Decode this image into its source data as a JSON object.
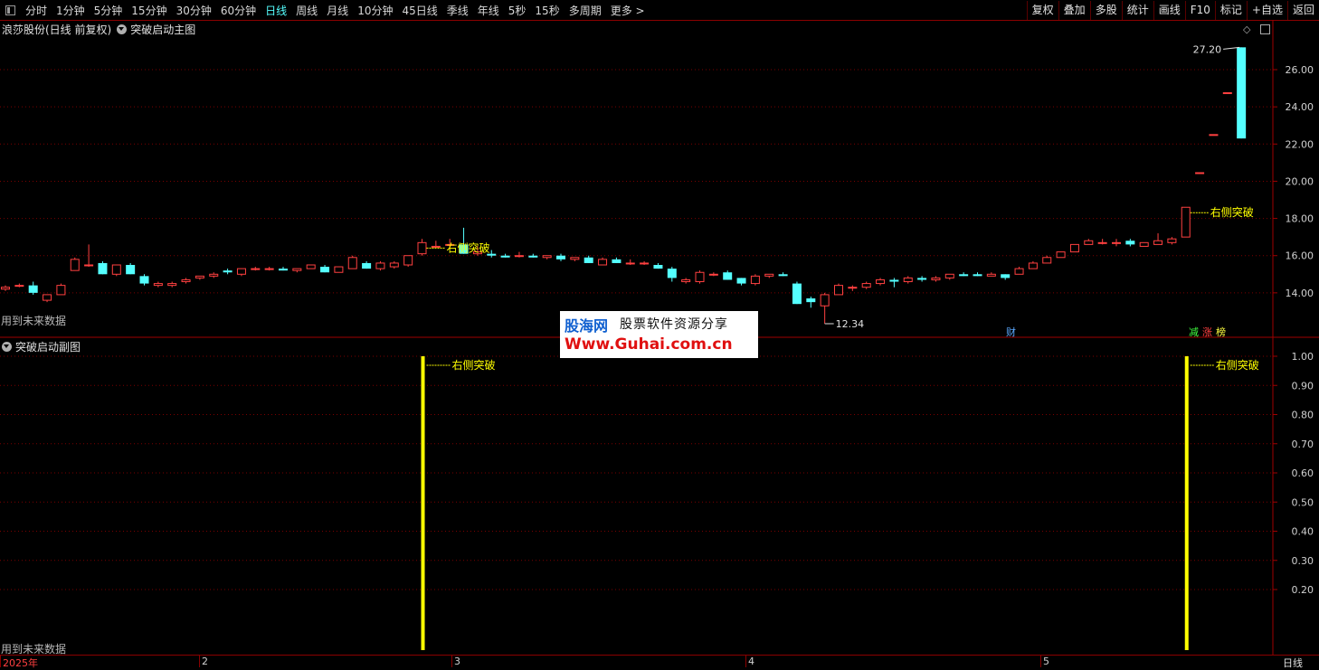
{
  "toolbar": {
    "periods": [
      "分时",
      "1分钟",
      "5分钟",
      "15分钟",
      "30分钟",
      "60分钟",
      "日线",
      "周线",
      "月线",
      "10分钟",
      "45日线",
      "季线",
      "年线",
      "5秒",
      "15秒",
      "多周期",
      "更多 >"
    ],
    "active_period": "日线",
    "right_buttons": [
      "复权",
      "叠加",
      "多股",
      "统计",
      "画线",
      "F10",
      "标记",
      "+自选",
      "返回"
    ]
  },
  "main_panel": {
    "title": "浪莎股份(日线 前复权)",
    "indicator": "突破启动主图",
    "footnote": "用到未来数据",
    "max_label": "27.20",
    "min_label": "12.34",
    "badges": {
      "cai": "财",
      "jian": "减",
      "zhang": "涨",
      "bang": "榜"
    },
    "signal_label": "右侧突破"
  },
  "sub_panel": {
    "indicator": "突破启动副图",
    "footnote": "用到未来数据",
    "signal_label": "右侧突破"
  },
  "x_axis": {
    "labels": [
      "2025年",
      "2",
      "3",
      "4",
      "5"
    ],
    "period_label": "日线"
  },
  "watermark": {
    "brand": "股海网",
    "slogan": "股票软件资源分享",
    "url": "Www.Guhai.com.cn"
  },
  "colors": {
    "up": "#ff4040",
    "down": "#54ffff",
    "signal": "#ffff00",
    "grid": "#7a0000",
    "border": "#a00000"
  },
  "chart_data": [
    {
      "type": "candlestick",
      "title": "浪莎股份(日线 前复权)",
      "ylim": [
        12,
        27.8
      ],
      "y_ticks": [
        14,
        16,
        18,
        20,
        22,
        24,
        26
      ],
      "x_tick_labels": [
        "2025年",
        "2",
        "3",
        "4",
        "5"
      ],
      "ohlc": [
        [
          14.2,
          14.4,
          14.1,
          14.3
        ],
        [
          14.4,
          14.5,
          14.3,
          14.4
        ],
        [
          14.4,
          14.6,
          13.9,
          14.0
        ],
        [
          13.6,
          13.9,
          13.5,
          13.9
        ],
        [
          13.9,
          14.5,
          13.9,
          14.4
        ],
        [
          15.2,
          15.9,
          15.2,
          15.8
        ],
        [
          15.5,
          16.6,
          15.4,
          15.5
        ],
        [
          15.6,
          15.7,
          15.0,
          15.0
        ],
        [
          15.0,
          15.5,
          14.9,
          15.5
        ],
        [
          15.5,
          15.6,
          15.0,
          15.0
        ],
        [
          14.9,
          15.0,
          14.4,
          14.5
        ],
        [
          14.4,
          14.6,
          14.3,
          14.5
        ],
        [
          14.4,
          14.6,
          14.3,
          14.5
        ],
        [
          14.6,
          14.8,
          14.5,
          14.7
        ],
        [
          14.8,
          14.9,
          14.7,
          14.9
        ],
        [
          14.9,
          15.1,
          14.8,
          15.0
        ],
        [
          15.2,
          15.3,
          15.0,
          15.1
        ],
        [
          15.0,
          15.3,
          14.9,
          15.3
        ],
        [
          15.3,
          15.4,
          15.2,
          15.3
        ],
        [
          15.3,
          15.4,
          15.2,
          15.3
        ],
        [
          15.3,
          15.4,
          15.2,
          15.2
        ],
        [
          15.2,
          15.3,
          15.1,
          15.3
        ],
        [
          15.3,
          15.5,
          15.3,
          15.5
        ],
        [
          15.4,
          15.5,
          15.1,
          15.1
        ],
        [
          15.1,
          15.4,
          15.1,
          15.4
        ],
        [
          15.3,
          16.0,
          15.3,
          15.9
        ],
        [
          15.6,
          15.7,
          15.3,
          15.3
        ],
        [
          15.3,
          15.7,
          15.2,
          15.6
        ],
        [
          15.4,
          15.7,
          15.3,
          15.6
        ],
        [
          15.5,
          16.0,
          15.4,
          16.0
        ],
        [
          16.1,
          16.9,
          16.0,
          16.7
        ],
        [
          16.5,
          16.8,
          16.4,
          16.5
        ],
        [
          16.6,
          16.9,
          16.4,
          16.6
        ],
        [
          16.6,
          17.5,
          16.1,
          16.1
        ],
        [
          16.1,
          16.5,
          16.0,
          16.2
        ],
        [
          16.1,
          16.3,
          15.9,
          16.0
        ],
        [
          16.0,
          16.1,
          15.9,
          15.9
        ],
        [
          16.0,
          16.2,
          15.9,
          16.0
        ],
        [
          16.0,
          16.1,
          15.9,
          15.9
        ],
        [
          15.9,
          16.0,
          15.8,
          16.0
        ],
        [
          16.0,
          16.1,
          15.7,
          15.8
        ],
        [
          15.8,
          15.9,
          15.7,
          15.9
        ],
        [
          15.9,
          16.0,
          15.6,
          15.6
        ],
        [
          15.5,
          15.9,
          15.5,
          15.8
        ],
        [
          15.8,
          15.9,
          15.6,
          15.6
        ],
        [
          15.6,
          15.8,
          15.5,
          15.6
        ],
        [
          15.6,
          15.7,
          15.5,
          15.6
        ],
        [
          15.5,
          15.6,
          15.3,
          15.3
        ],
        [
          15.3,
          15.4,
          14.6,
          14.8
        ],
        [
          14.6,
          14.8,
          14.5,
          14.7
        ],
        [
          14.6,
          15.2,
          14.5,
          15.1
        ],
        [
          15.0,
          15.1,
          14.9,
          15.0
        ],
        [
          15.1,
          15.2,
          14.7,
          14.7
        ],
        [
          14.8,
          14.8,
          14.4,
          14.5
        ],
        [
          14.5,
          15.0,
          14.4,
          14.9
        ],
        [
          14.9,
          15.0,
          14.8,
          15.0
        ],
        [
          15.0,
          15.1,
          14.9,
          14.9
        ],
        [
          14.5,
          14.6,
          13.4,
          13.4
        ],
        [
          13.7,
          13.8,
          13.2,
          13.5
        ],
        [
          13.3,
          14.0,
          12.34,
          13.9
        ],
        [
          13.9,
          14.5,
          13.9,
          14.4
        ],
        [
          14.3,
          14.4,
          14.1,
          14.3
        ],
        [
          14.3,
          14.6,
          14.2,
          14.5
        ],
        [
          14.5,
          14.8,
          14.4,
          14.7
        ],
        [
          14.7,
          14.8,
          14.3,
          14.6
        ],
        [
          14.6,
          14.9,
          14.5,
          14.8
        ],
        [
          14.8,
          14.9,
          14.6,
          14.7
        ],
        [
          14.7,
          14.9,
          14.6,
          14.8
        ],
        [
          14.8,
          15.0,
          14.7,
          15.0
        ],
        [
          15.0,
          15.1,
          14.9,
          14.9
        ],
        [
          15.0,
          15.1,
          14.9,
          14.9
        ],
        [
          14.9,
          15.1,
          14.9,
          15.0
        ],
        [
          15.0,
          15.0,
          14.7,
          14.8
        ],
        [
          15.0,
          15.4,
          15.0,
          15.3
        ],
        [
          15.3,
          15.7,
          15.3,
          15.6
        ],
        [
          15.6,
          16.0,
          15.6,
          15.9
        ],
        [
          15.9,
          16.2,
          15.9,
          16.2
        ],
        [
          16.2,
          16.6,
          16.2,
          16.6
        ],
        [
          16.6,
          16.9,
          16.6,
          16.8
        ],
        [
          16.7,
          16.9,
          16.6,
          16.7
        ],
        [
          16.7,
          16.9,
          16.5,
          16.7
        ],
        [
          16.8,
          16.9,
          16.5,
          16.6
        ],
        [
          16.5,
          16.7,
          16.5,
          16.7
        ],
        [
          16.6,
          17.2,
          16.6,
          16.8
        ],
        [
          16.7,
          17.0,
          16.6,
          16.9
        ],
        [
          17.0,
          18.6,
          17.0,
          18.6
        ],
        [
          20.46,
          20.46,
          20.46,
          20.46
        ],
        [
          22.51,
          22.51,
          22.51,
          22.51
        ],
        [
          24.76,
          24.76,
          24.76,
          24.76
        ],
        [
          27.2,
          27.2,
          22.3,
          22.3
        ]
      ],
      "signals": [
        {
          "index": 30,
          "label": "右侧突破"
        },
        {
          "index": 85,
          "label": "右侧突破"
        }
      ],
      "max": {
        "index": 89,
        "value": 27.2
      },
      "min": {
        "index": 59,
        "value": 12.34
      }
    },
    {
      "type": "bar",
      "title": "突破启动副图",
      "ylim": [
        0,
        1.05
      ],
      "y_ticks": [
        0.2,
        0.3,
        0.4,
        0.5,
        0.6,
        0.7,
        0.8,
        0.9,
        1.0
      ],
      "bars": [
        {
          "index": 30,
          "value": 1.0,
          "label": "右侧突破"
        },
        {
          "index": 85,
          "value": 1.0,
          "label": "右侧突破"
        }
      ]
    }
  ]
}
